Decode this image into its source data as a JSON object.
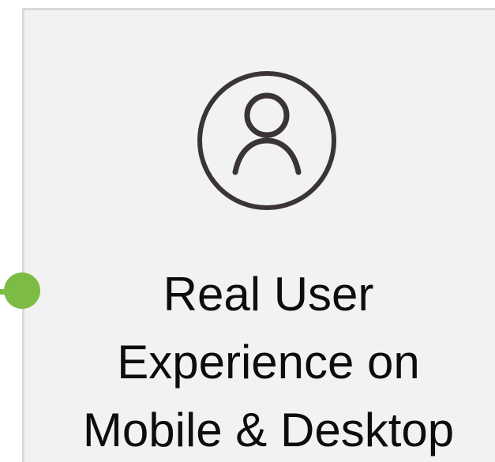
{
  "card": {
    "title_lines": [
      "Real User",
      "Experience on",
      "Mobile & Desktop"
    ],
    "icon": "user-circle-icon"
  },
  "colors": {
    "card_background": "#f2f2f2",
    "card_border": "#d9d9d9",
    "connector_accent": "#7cbc44",
    "icon_stroke": "#3a3435",
    "text": "#0d0d0d"
  }
}
